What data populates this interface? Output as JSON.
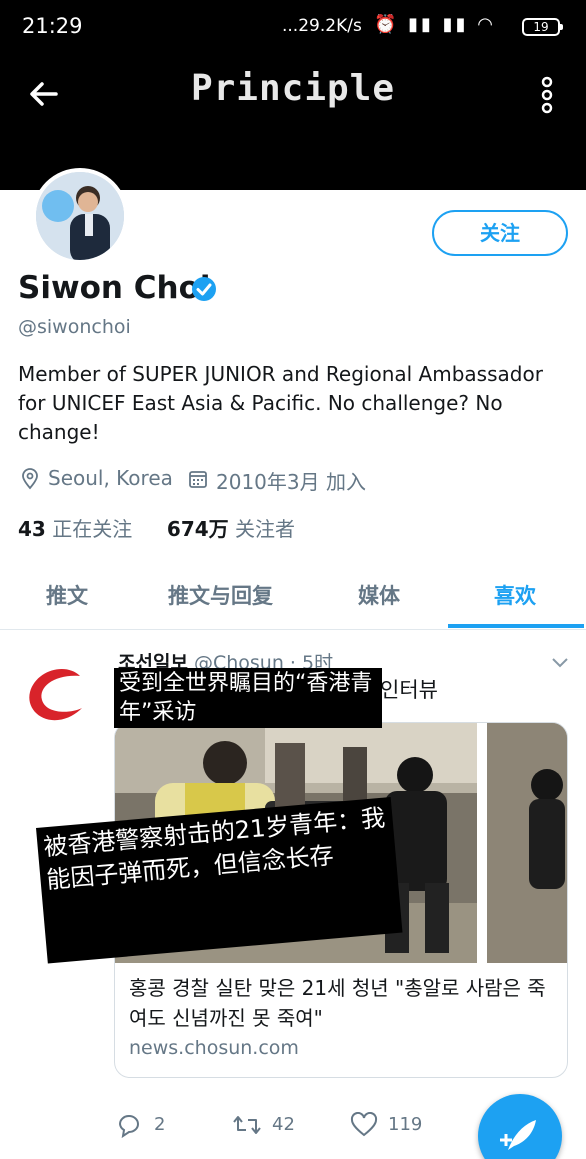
{
  "status_bar": {
    "time": "21:29",
    "network_speed": "...29.2K/s",
    "battery": "19"
  },
  "header": {
    "title": "Principle"
  },
  "profile": {
    "follow_label": "关注",
    "name": "Siwon Choi",
    "handle": "@siwonchoi",
    "bio": "Member of SUPER JUNIOR and Regional Ambassador for UNICEF East Asia & Pacific. No challenge? No change!",
    "location": "Seoul, Korea",
    "joined": "2010年3月 加入",
    "following_count": "43",
    "following_label": "正在关注",
    "followers_count": "674万",
    "followers_label": "关注者"
  },
  "tabs": [
    {
      "label": "推文"
    },
    {
      "label": "推文与回复"
    },
    {
      "label": "媒体"
    },
    {
      "label": "喜欢"
    }
  ],
  "tweet": {
    "author": "조선일보",
    "account": "@Chosun · 5时",
    "text_fragment": "인터뷰",
    "overlay_caption_1": "受到全世界瞩目的“香港青年”采访",
    "overlay_caption_2": "被香港警察射击的21岁青年：我能因子弹而死，但信念长存",
    "card_title": "홍콩 경찰 실탄 맞은 21세 청년 \"총알로 사람은 죽여도 신념까진 못 죽여\"",
    "card_domain": "news.chosun.com",
    "replies": "2",
    "retweets": "42",
    "likes": "119"
  },
  "colors": {
    "accent": "#1da1f2",
    "header_bg": "#000000",
    "secondary_text": "#657786",
    "chosun_red": "#d8232a"
  }
}
